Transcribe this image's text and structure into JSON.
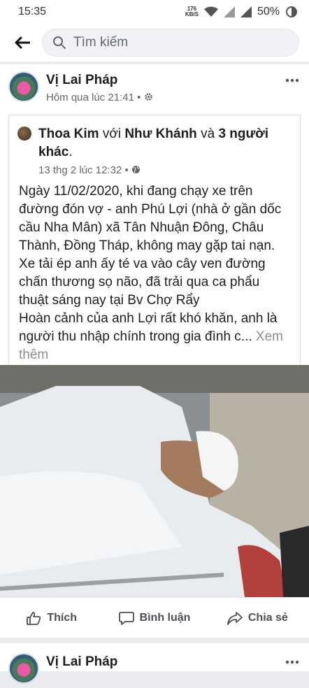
{
  "status": {
    "time": "15:35",
    "speed_top": "176",
    "speed_unit": "KB/S",
    "battery": "50%"
  },
  "search": {
    "placeholder": "Tìm kiếm"
  },
  "post": {
    "author": "Vị Lai Pháp",
    "time": "Hôm qua lúc 21:41",
    "dot": "•",
    "shared": {
      "author": "Thoa Kim",
      "with": "với",
      "tagged": "Như Khánh",
      "and": "và",
      "others": "3 người khác",
      "period": ".",
      "time": "13 thg 2 lúc 12:32",
      "dot": "•"
    },
    "text": "Ngày 11/02/2020, khi đang chạy xe trên đường đón vợ - anh Phú Lợi (nhà ở gần dốc cầu Nha Mân) xã Tân Nhuận Đông, Châu Thành, Đồng Tháp, không may gặp tai nạn. Xe tải ép anh ấy té va vào cây ven đường chấn thương sọ não, đã trải qua ca phẩu thuật sáng nay tại Bv Chợ Rẩy\nHoàn cảnh của anh Lợi rất khó khăn, anh là người thu nhập chính trong gia đình c...",
    "see_more": " Xem thêm",
    "actions": {
      "like": "Thích",
      "comment": "Bình luận",
      "share": "Chia sẻ"
    }
  },
  "post2": {
    "author": "Vị Lai Pháp"
  }
}
